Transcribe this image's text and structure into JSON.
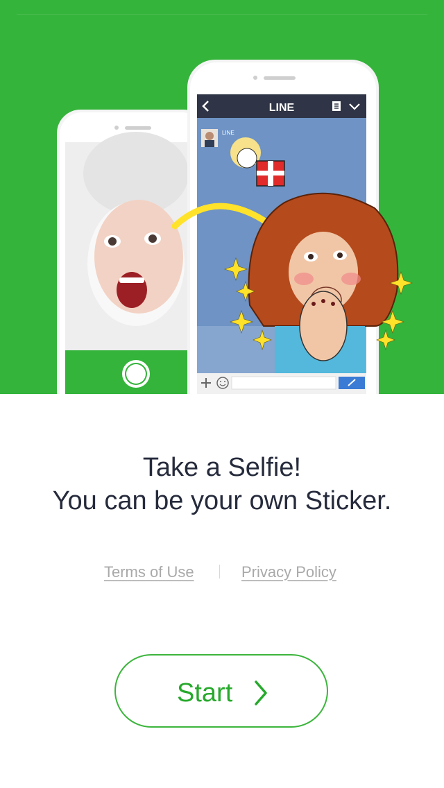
{
  "hero": {
    "icons": [
      "back-chevron-icon",
      "menu-icon",
      "chevron-down-icon",
      "plus-icon",
      "emoji-icon",
      "send-icon",
      "shutter-icon"
    ],
    "chat_header_title": "LINE",
    "chat_sender_name": "LINE",
    "colors": {
      "background": "#34b43b",
      "chat_header": "#2f3546",
      "chat_bg": "#6e93c4",
      "arrow": "#ffe22a"
    }
  },
  "headline": {
    "line1": "Take a Selfie!",
    "line2": "You can be your own Sticker."
  },
  "links": {
    "terms": "Terms of Use",
    "privacy": "Privacy Policy"
  },
  "start_button": {
    "label": "Start",
    "icon": "chevron-right-icon",
    "color": "#3cb53c"
  }
}
